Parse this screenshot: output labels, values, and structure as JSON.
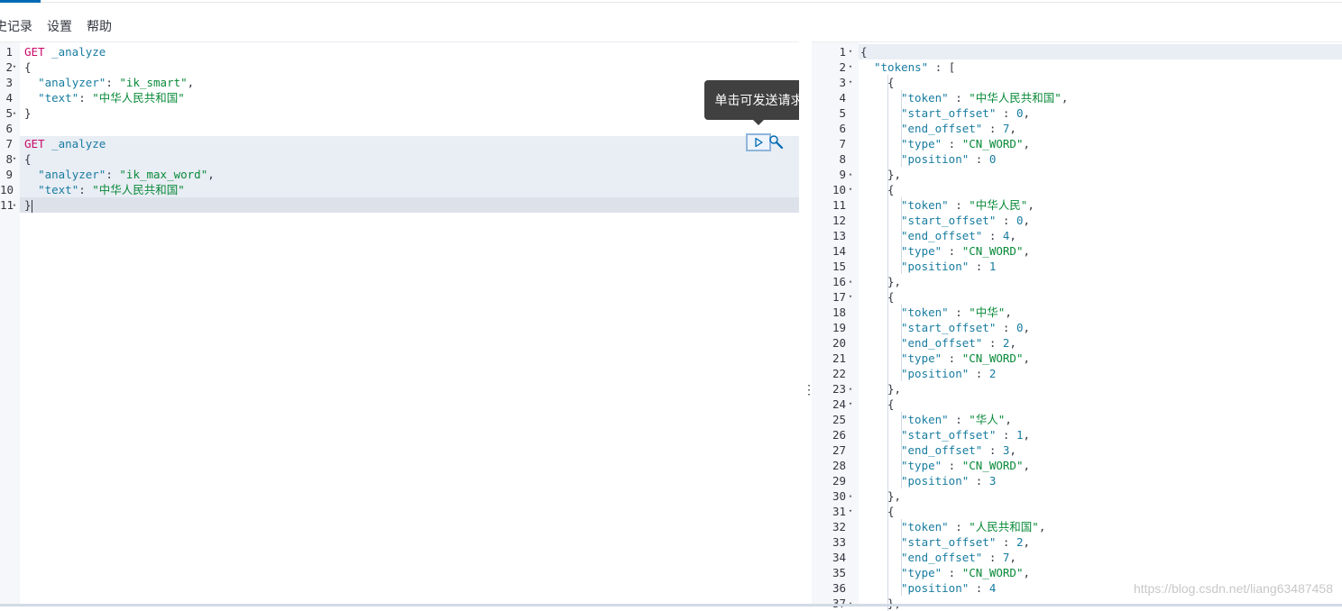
{
  "menu": {
    "items": [
      "史记录",
      "设置",
      "帮助"
    ]
  },
  "editor": {
    "tooltip": "单击可发送请求",
    "lines": [
      {
        "n": "1",
        "fold": "",
        "t": [
          [
            "m",
            "GET"
          ],
          [
            "p",
            " "
          ],
          [
            "u",
            "_analyze"
          ]
        ]
      },
      {
        "n": "2",
        "fold": "▾",
        "t": [
          [
            "p",
            "{"
          ]
        ]
      },
      {
        "n": "3",
        "fold": "",
        "t": [
          [
            "p",
            "  "
          ],
          [
            "k",
            "\"analyzer\""
          ],
          [
            "p",
            ": "
          ],
          [
            "s",
            "\"ik_smart\""
          ],
          [
            "p",
            ","
          ]
        ]
      },
      {
        "n": "4",
        "fold": "",
        "t": [
          [
            "p",
            "  "
          ],
          [
            "k",
            "\"text\""
          ],
          [
            "p",
            ": "
          ],
          [
            "s",
            "\"中华人民共和国\""
          ]
        ]
      },
      {
        "n": "5",
        "fold": "▴",
        "t": [
          [
            "p",
            "}"
          ]
        ]
      },
      {
        "n": "6",
        "fold": "",
        "t": []
      },
      {
        "n": "7",
        "fold": "",
        "t": [
          [
            "m",
            "GET"
          ],
          [
            "p",
            " "
          ],
          [
            "u",
            "_analyze"
          ]
        ]
      },
      {
        "n": "8",
        "fold": "▾",
        "t": [
          [
            "p",
            "{"
          ]
        ]
      },
      {
        "n": "9",
        "fold": "",
        "t": [
          [
            "p",
            "  "
          ],
          [
            "k",
            "\"analyzer\""
          ],
          [
            "p",
            ": "
          ],
          [
            "s",
            "\"ik_max_word\""
          ],
          [
            "p",
            ","
          ]
        ]
      },
      {
        "n": "10",
        "fold": "",
        "t": [
          [
            "p",
            "  "
          ],
          [
            "k",
            "\"text\""
          ],
          [
            "p",
            ": "
          ],
          [
            "s",
            "\"中华人民共和国\""
          ]
        ]
      },
      {
        "n": "11",
        "fold": "▴",
        "t": [
          [
            "p",
            "}"
          ]
        ]
      }
    ]
  },
  "output": {
    "lines": [
      {
        "n": "1",
        "fold": "▾",
        "i": 0,
        "t": [
          [
            "p",
            "{"
          ]
        ]
      },
      {
        "n": "2",
        "fold": "▾",
        "i": 1,
        "t": [
          [
            "k",
            "\"tokens\""
          ],
          [
            "p",
            " : ["
          ]
        ]
      },
      {
        "n": "3",
        "fold": "▾",
        "i": 2,
        "t": [
          [
            "p",
            "{"
          ]
        ]
      },
      {
        "n": "4",
        "fold": "",
        "i": 3,
        "t": [
          [
            "k",
            "\"token\""
          ],
          [
            "p",
            " : "
          ],
          [
            "s",
            "\"中华人民共和国\""
          ],
          [
            "p",
            ","
          ]
        ]
      },
      {
        "n": "5",
        "fold": "",
        "i": 3,
        "t": [
          [
            "k",
            "\"start_offset\""
          ],
          [
            "p",
            " : "
          ],
          [
            "n",
            "0"
          ],
          [
            "p",
            ","
          ]
        ]
      },
      {
        "n": "6",
        "fold": "",
        "i": 3,
        "t": [
          [
            "k",
            "\"end_offset\""
          ],
          [
            "p",
            " : "
          ],
          [
            "n",
            "7"
          ],
          [
            "p",
            ","
          ]
        ]
      },
      {
        "n": "7",
        "fold": "",
        "i": 3,
        "t": [
          [
            "k",
            "\"type\""
          ],
          [
            "p",
            " : "
          ],
          [
            "s",
            "\"CN_WORD\""
          ],
          [
            "p",
            ","
          ]
        ]
      },
      {
        "n": "8",
        "fold": "",
        "i": 3,
        "t": [
          [
            "k",
            "\"position\""
          ],
          [
            "p",
            " : "
          ],
          [
            "n",
            "0"
          ]
        ]
      },
      {
        "n": "9",
        "fold": "▴",
        "i": 2,
        "t": [
          [
            "p",
            "},"
          ]
        ]
      },
      {
        "n": "10",
        "fold": "▾",
        "i": 2,
        "t": [
          [
            "p",
            "{"
          ]
        ]
      },
      {
        "n": "11",
        "fold": "",
        "i": 3,
        "t": [
          [
            "k",
            "\"token\""
          ],
          [
            "p",
            " : "
          ],
          [
            "s",
            "\"中华人民\""
          ],
          [
            "p",
            ","
          ]
        ]
      },
      {
        "n": "12",
        "fold": "",
        "i": 3,
        "t": [
          [
            "k",
            "\"start_offset\""
          ],
          [
            "p",
            " : "
          ],
          [
            "n",
            "0"
          ],
          [
            "p",
            ","
          ]
        ]
      },
      {
        "n": "13",
        "fold": "",
        "i": 3,
        "t": [
          [
            "k",
            "\"end_offset\""
          ],
          [
            "p",
            " : "
          ],
          [
            "n",
            "4"
          ],
          [
            "p",
            ","
          ]
        ]
      },
      {
        "n": "14",
        "fold": "",
        "i": 3,
        "t": [
          [
            "k",
            "\"type\""
          ],
          [
            "p",
            " : "
          ],
          [
            "s",
            "\"CN_WORD\""
          ],
          [
            "p",
            ","
          ]
        ]
      },
      {
        "n": "15",
        "fold": "",
        "i": 3,
        "t": [
          [
            "k",
            "\"position\""
          ],
          [
            "p",
            " : "
          ],
          [
            "n",
            "1"
          ]
        ]
      },
      {
        "n": "16",
        "fold": "▴",
        "i": 2,
        "t": [
          [
            "p",
            "},"
          ]
        ]
      },
      {
        "n": "17",
        "fold": "▾",
        "i": 2,
        "t": [
          [
            "p",
            "{"
          ]
        ]
      },
      {
        "n": "18",
        "fold": "",
        "i": 3,
        "t": [
          [
            "k",
            "\"token\""
          ],
          [
            "p",
            " : "
          ],
          [
            "s",
            "\"中华\""
          ],
          [
            "p",
            ","
          ]
        ]
      },
      {
        "n": "19",
        "fold": "",
        "i": 3,
        "t": [
          [
            "k",
            "\"start_offset\""
          ],
          [
            "p",
            " : "
          ],
          [
            "n",
            "0"
          ],
          [
            "p",
            ","
          ]
        ]
      },
      {
        "n": "20",
        "fold": "",
        "i": 3,
        "t": [
          [
            "k",
            "\"end_offset\""
          ],
          [
            "p",
            " : "
          ],
          [
            "n",
            "2"
          ],
          [
            "p",
            ","
          ]
        ]
      },
      {
        "n": "21",
        "fold": "",
        "i": 3,
        "t": [
          [
            "k",
            "\"type\""
          ],
          [
            "p",
            " : "
          ],
          [
            "s",
            "\"CN_WORD\""
          ],
          [
            "p",
            ","
          ]
        ]
      },
      {
        "n": "22",
        "fold": "",
        "i": 3,
        "t": [
          [
            "k",
            "\"position\""
          ],
          [
            "p",
            " : "
          ],
          [
            "n",
            "2"
          ]
        ]
      },
      {
        "n": "23",
        "fold": "▴",
        "i": 2,
        "t": [
          [
            "p",
            "},"
          ]
        ]
      },
      {
        "n": "24",
        "fold": "▾",
        "i": 2,
        "t": [
          [
            "p",
            "{"
          ]
        ]
      },
      {
        "n": "25",
        "fold": "",
        "i": 3,
        "t": [
          [
            "k",
            "\"token\""
          ],
          [
            "p",
            " : "
          ],
          [
            "s",
            "\"华人\""
          ],
          [
            "p",
            ","
          ]
        ]
      },
      {
        "n": "26",
        "fold": "",
        "i": 3,
        "t": [
          [
            "k",
            "\"start_offset\""
          ],
          [
            "p",
            " : "
          ],
          [
            "n",
            "1"
          ],
          [
            "p",
            ","
          ]
        ]
      },
      {
        "n": "27",
        "fold": "",
        "i": 3,
        "t": [
          [
            "k",
            "\"end_offset\""
          ],
          [
            "p",
            " : "
          ],
          [
            "n",
            "3"
          ],
          [
            "p",
            ","
          ]
        ]
      },
      {
        "n": "28",
        "fold": "",
        "i": 3,
        "t": [
          [
            "k",
            "\"type\""
          ],
          [
            "p",
            " : "
          ],
          [
            "s",
            "\"CN_WORD\""
          ],
          [
            "p",
            ","
          ]
        ]
      },
      {
        "n": "29",
        "fold": "",
        "i": 3,
        "t": [
          [
            "k",
            "\"position\""
          ],
          [
            "p",
            " : "
          ],
          [
            "n",
            "3"
          ]
        ]
      },
      {
        "n": "30",
        "fold": "▴",
        "i": 2,
        "t": [
          [
            "p",
            "},"
          ]
        ]
      },
      {
        "n": "31",
        "fold": "▾",
        "i": 2,
        "t": [
          [
            "p",
            "{"
          ]
        ]
      },
      {
        "n": "32",
        "fold": "",
        "i": 3,
        "t": [
          [
            "k",
            "\"token\""
          ],
          [
            "p",
            " : "
          ],
          [
            "s",
            "\"人民共和国\""
          ],
          [
            "p",
            ","
          ]
        ]
      },
      {
        "n": "33",
        "fold": "",
        "i": 3,
        "t": [
          [
            "k",
            "\"start_offset\""
          ],
          [
            "p",
            " : "
          ],
          [
            "n",
            "2"
          ],
          [
            "p",
            ","
          ]
        ]
      },
      {
        "n": "34",
        "fold": "",
        "i": 3,
        "t": [
          [
            "k",
            "\"end_offset\""
          ],
          [
            "p",
            " : "
          ],
          [
            "n",
            "7"
          ],
          [
            "p",
            ","
          ]
        ]
      },
      {
        "n": "35",
        "fold": "",
        "i": 3,
        "t": [
          [
            "k",
            "\"type\""
          ],
          [
            "p",
            " : "
          ],
          [
            "s",
            "\"CN_WORD\""
          ],
          [
            "p",
            ","
          ]
        ]
      },
      {
        "n": "36",
        "fold": "",
        "i": 3,
        "t": [
          [
            "k",
            "\"position\""
          ],
          [
            "p",
            " : "
          ],
          [
            "n",
            "4"
          ]
        ]
      },
      {
        "n": "37",
        "fold": "▴",
        "i": 2,
        "t": [
          [
            "p",
            "},"
          ]
        ]
      }
    ]
  },
  "icons": {
    "run": "play-icon",
    "settings": "wrench-icon",
    "resize": "vertical-dots-icon"
  },
  "watermark": "https://blog.csdn.net/liang63487458",
  "colors": {
    "method": "#c80a68",
    "key": "#187ca0",
    "string": "#0a8a3a",
    "accent": "#006bb4"
  }
}
